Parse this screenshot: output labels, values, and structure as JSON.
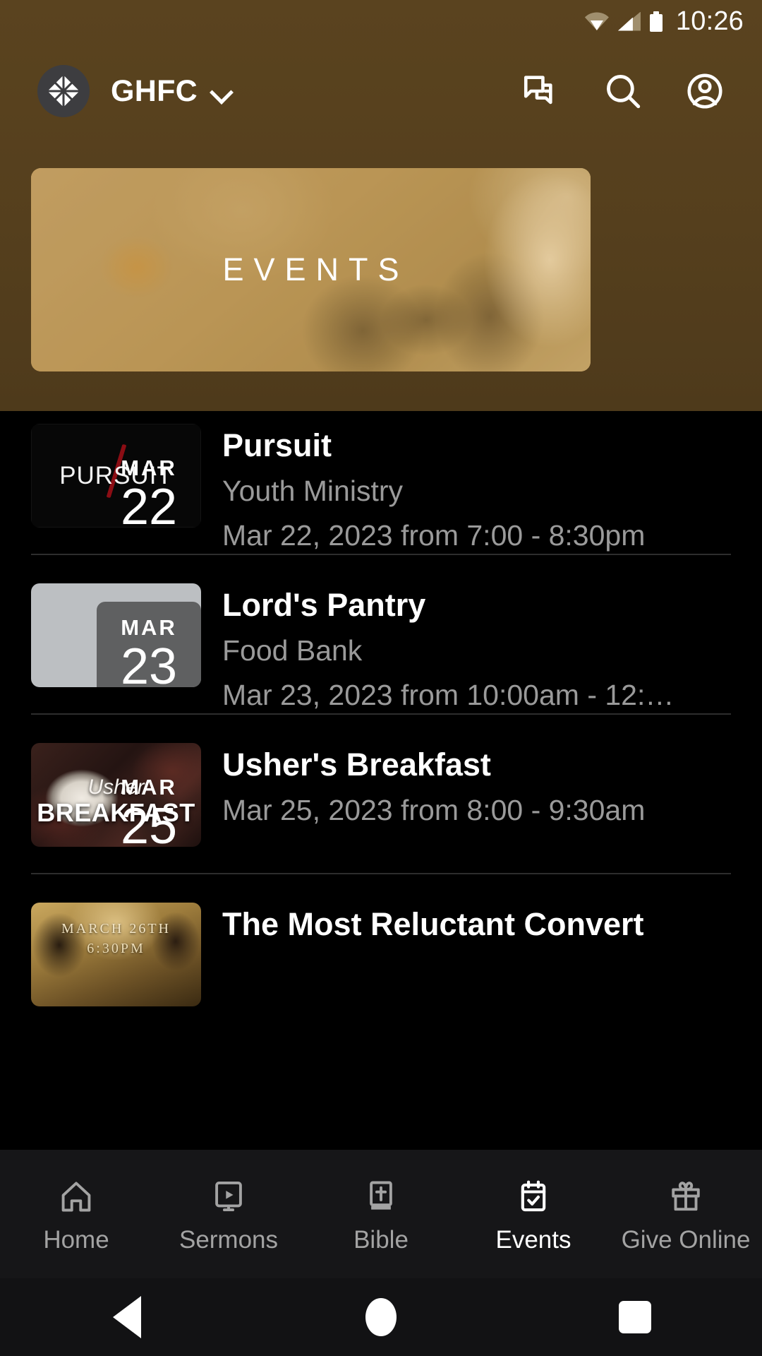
{
  "status_bar": {
    "time": "10:26",
    "icons": [
      "wifi-icon",
      "cellular-signal-icon",
      "battery-icon"
    ]
  },
  "app_bar": {
    "logo": "church-diamond-logo-icon",
    "org_name": "GHFC",
    "dropdown_icon": "chevron-down-icon",
    "actions": [
      {
        "name": "messages-icon",
        "label": "Messages"
      },
      {
        "name": "search-icon",
        "label": "Search"
      },
      {
        "name": "account-icon",
        "label": "Account"
      }
    ]
  },
  "hero": {
    "title": "EVENTS"
  },
  "colors": {
    "header_brown": "#53401d",
    "hero_tan": "#b99657",
    "page_background": "#000000",
    "tabbar_background": "#161618",
    "secondary_text": "#9a9a9a",
    "active_tab": "#ffffff"
  },
  "events": [
    {
      "title": "Pursuit",
      "subtitle": "Youth Ministry",
      "when": "Mar 22, 2023 from 7:00 - 8:30pm",
      "date_month": "MAR",
      "date_day": "22",
      "thumb_text_1": "PURSUIT",
      "thumb_style": "pursuit"
    },
    {
      "title": "Lord's Pantry",
      "subtitle": "Food Bank",
      "when": "Mar 23, 2023 from 10:00am - 12:…",
      "date_month": "MAR",
      "date_day": "23",
      "thumb_text_1": "",
      "thumb_style": "pantry"
    },
    {
      "title": "Usher's Breakfast",
      "subtitle": "",
      "when": "Mar 25, 2023 from 8:00 - 9:30am",
      "date_month": "MAR",
      "date_day": "25",
      "thumb_text_1": "Usher",
      "thumb_text_2": "BREAKFAST",
      "thumb_style": "breakfast"
    },
    {
      "title": "The Most Reluctant Convert",
      "subtitle": "",
      "when": "",
      "date_month": "",
      "date_day": "",
      "thumb_text_1": "MARCH 26TH",
      "thumb_text_2": "6:30PM",
      "thumb_style": "convert"
    }
  ],
  "tab_bar": {
    "items": [
      {
        "label": "Home",
        "icon": "home-icon",
        "active": false
      },
      {
        "label": "Sermons",
        "icon": "sermons-icon",
        "active": false
      },
      {
        "label": "Bible",
        "icon": "bible-icon",
        "active": false
      },
      {
        "label": "Events",
        "icon": "calendar-check-icon",
        "active": true
      },
      {
        "label": "Give Online",
        "icon": "gift-icon",
        "active": false
      }
    ]
  },
  "system_nav": {
    "back": "back-triangle-icon",
    "home": "home-circle-icon",
    "recents": "recents-square-icon"
  }
}
